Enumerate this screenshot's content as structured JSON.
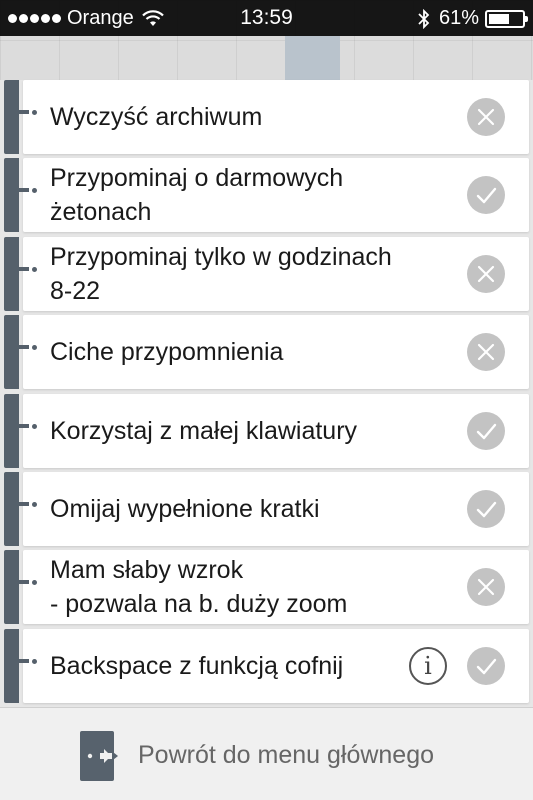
{
  "status_bar": {
    "carrier": "Orange",
    "time": "13:59",
    "battery_percent": "61%",
    "battery_level": 0.61
  },
  "settings": [
    {
      "label": "Wyczyść archiwum",
      "state": "off",
      "icon": "x-icon"
    },
    {
      "label": "Przypominaj o darmowych\nżetonach",
      "state": "on",
      "icon": "check-icon"
    },
    {
      "label": "Przypominaj tylko w godzinach\n8-22",
      "state": "off",
      "icon": "x-icon"
    },
    {
      "label": "Ciche przypomnienia",
      "state": "off",
      "icon": "x-icon"
    },
    {
      "label": "Korzystaj z małej klawiatury",
      "state": "on",
      "icon": "check-icon"
    },
    {
      "label": "Omijaj wypełnione kratki",
      "state": "on",
      "icon": "check-icon"
    },
    {
      "label": "Mam słaby wzrok\n- pozwala na b. duży zoom",
      "state": "off",
      "icon": "x-icon"
    },
    {
      "label": "Backspace z funkcją cofnij",
      "state": "on",
      "icon": "check-icon",
      "info": "i"
    }
  ],
  "footer": {
    "label": "Powrót do menu głównego",
    "icon": "exit-door-icon"
  }
}
